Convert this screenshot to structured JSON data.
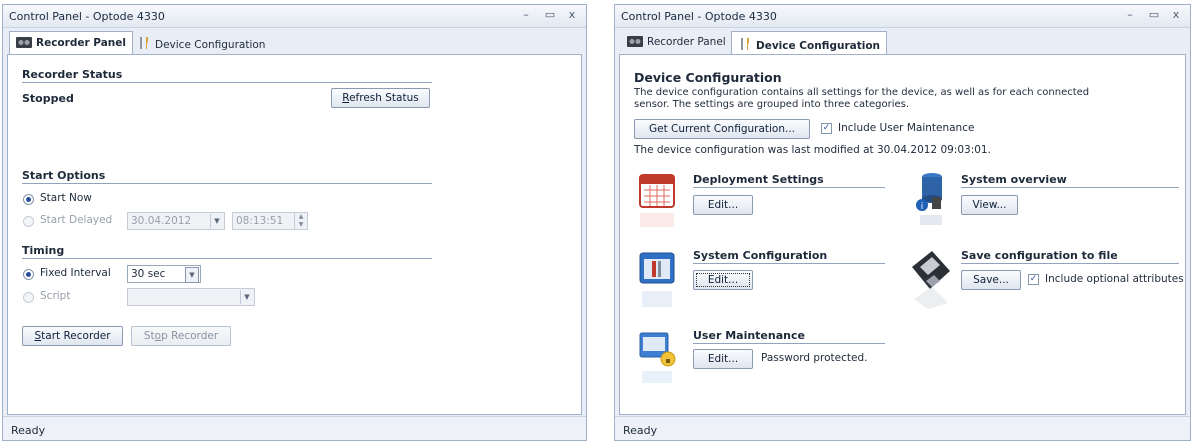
{
  "left": {
    "title": "Control Panel - Optode 4330",
    "tabs": [
      "Recorder Panel",
      "Device Configuration"
    ],
    "recorder_status": {
      "heading": "Recorder Status",
      "state": "Stopped",
      "refresh_label": "Refresh Status"
    },
    "start_options": {
      "heading": "Start Options",
      "start_now": "Start Now",
      "start_delayed": "Start Delayed",
      "date_value": "30.04.2012",
      "time_value": "08:13:51",
      "start_now_selected": true
    },
    "timing": {
      "heading": "Timing",
      "fixed_interval": "Fixed Interval",
      "interval_value": "30 sec",
      "script": "Script",
      "script_value": ""
    },
    "buttons": {
      "start": "Start Recorder",
      "stop": "Stop Recorder"
    },
    "status_bar": "Ready"
  },
  "right": {
    "title": "Control Panel - Optode 4330",
    "tabs": [
      "Recorder Panel",
      "Device Configuration"
    ],
    "heading": "Device Configuration",
    "description": [
      "The device configuration contains all settings for the device, as well as for each connected",
      "sensor. The settings are grouped into three categories."
    ],
    "get_config_label": "Get Current Configuration...",
    "include_user_maintenance": "Include User Maintenance",
    "last_modified": "The device configuration was last modified at 30.04.2012 09:03:01.",
    "sections": {
      "deployment": {
        "title": "Deployment Settings",
        "button": "Edit..."
      },
      "system_overview": {
        "title": "System overview",
        "button": "View..."
      },
      "system_configuration": {
        "title": "System Configuration",
        "button": "Edit..."
      },
      "save_config": {
        "title": "Save configuration to file",
        "button": "Save...",
        "checkbox": "Include optional attributes"
      },
      "user_maintenance": {
        "title": "User Maintenance",
        "button": "Edit...",
        "note": "Password protected."
      }
    },
    "status_bar": "Ready"
  },
  "icons": [
    "calendar-icon",
    "database-info-icon",
    "tools-window-icon",
    "floppy-disk-icon",
    "user-maintenance-icon",
    "recorder-icon",
    "wrench-screwdriver-icon"
  ],
  "colors": {
    "accent": "#2a4f9a",
    "border": "#9fb0c8",
    "window_bg": "#e9eef6"
  }
}
